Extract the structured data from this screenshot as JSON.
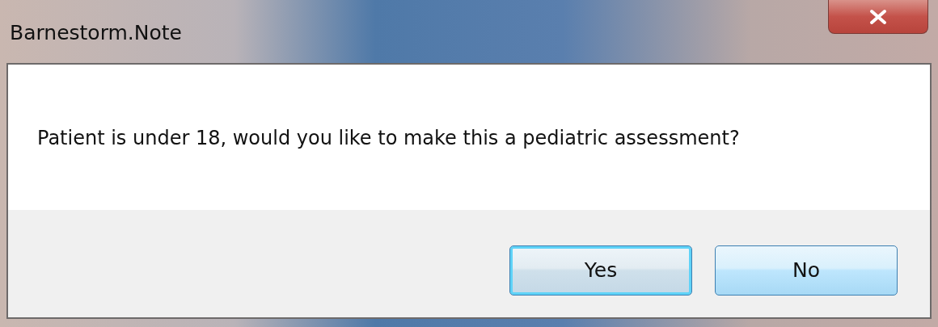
{
  "window": {
    "title": "Barnestorm.Note"
  },
  "message": "Patient is under 18, would you like to make this a pediatric assessment?",
  "buttons": [
    {
      "label": "Yes",
      "default": true
    },
    {
      "label": "No",
      "default": false
    }
  ]
}
